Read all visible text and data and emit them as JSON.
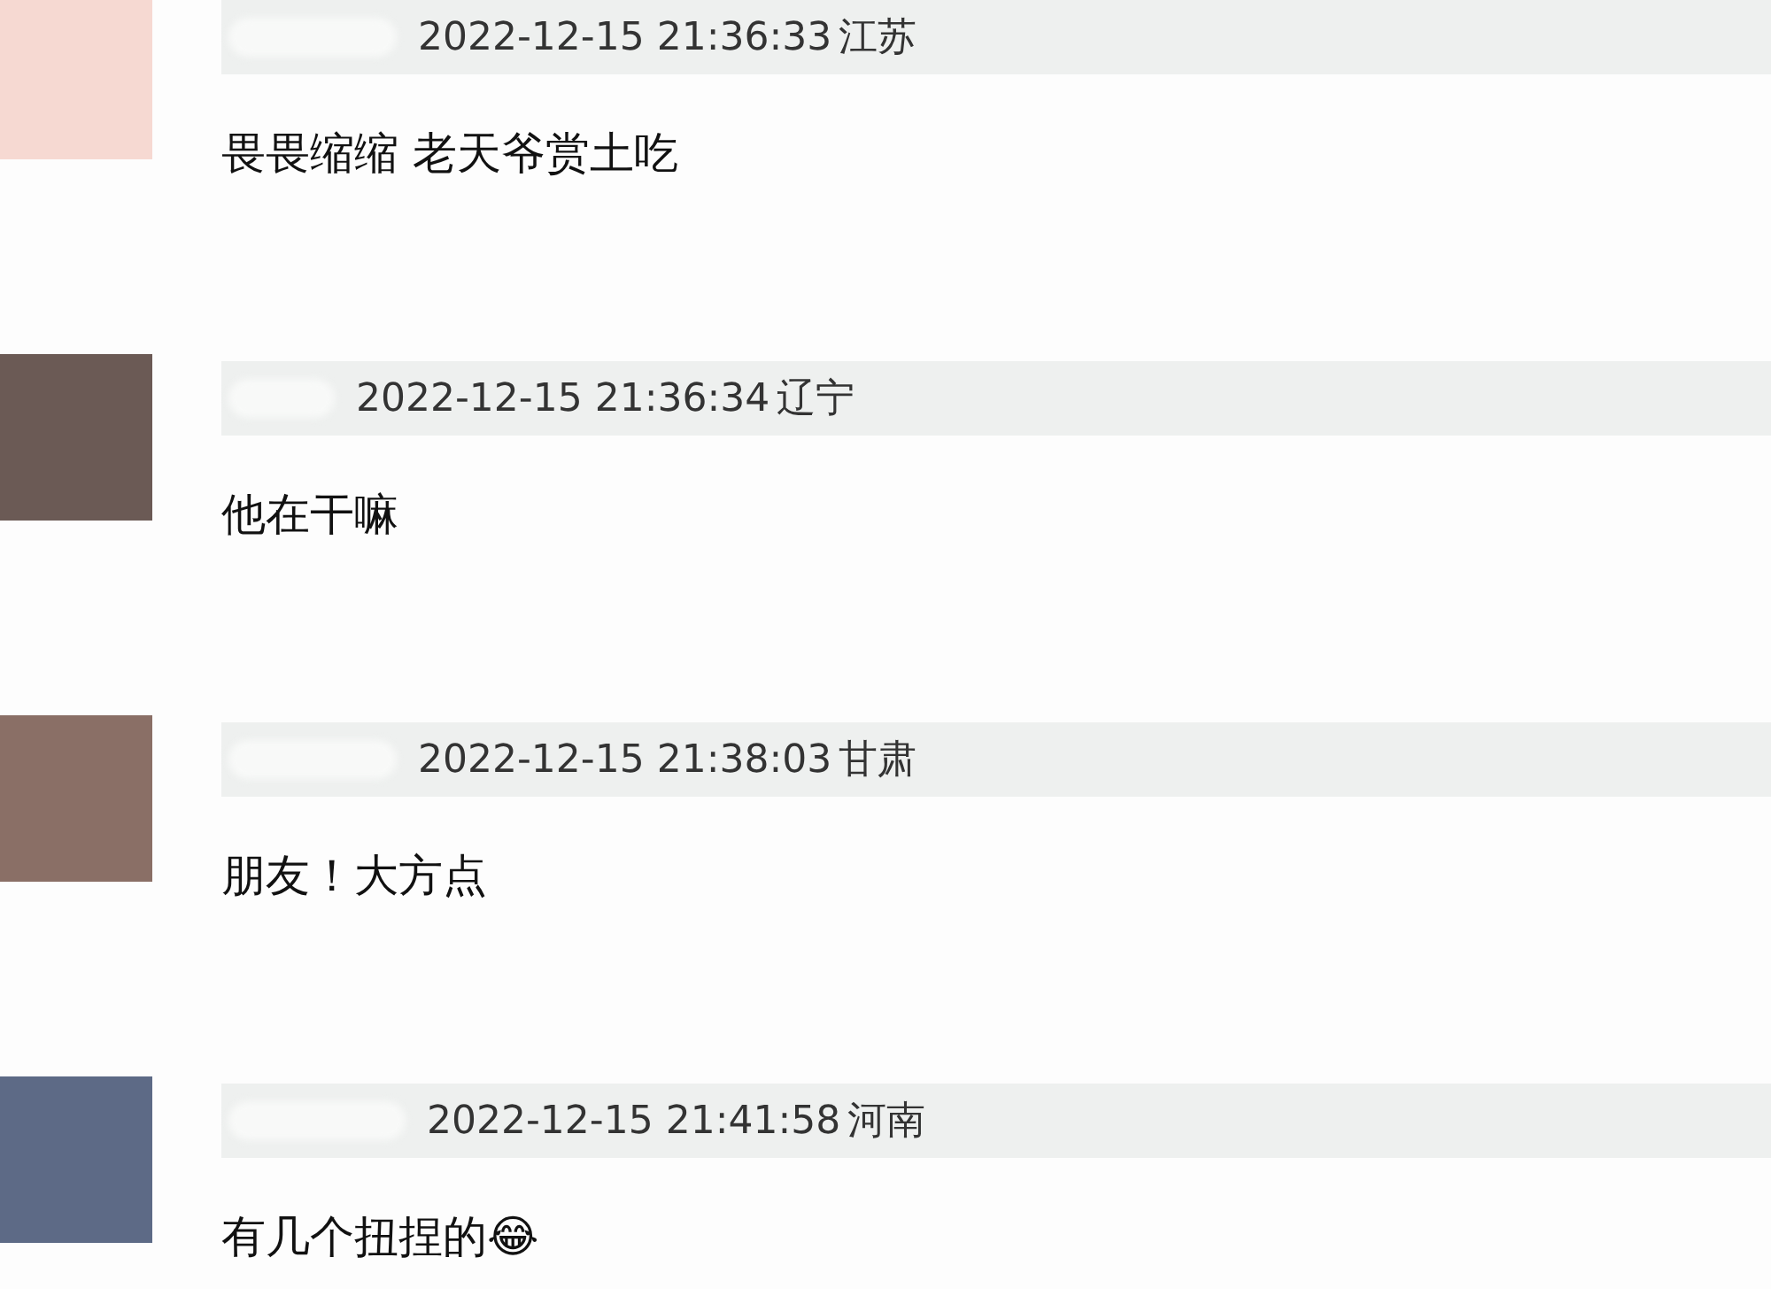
{
  "comments": [
    {
      "time": "2022-12-15 21:36:33",
      "region": "江苏",
      "text": "畏畏缩缩 老天爷赏土吃"
    },
    {
      "time": "2022-12-15 21:36:34",
      "region": "辽宁",
      "text": "他在干嘛"
    },
    {
      "time": "2022-12-15 21:38:03",
      "region": "甘肃",
      "text": "朋友！大方点"
    },
    {
      "time": "2022-12-15 21:41:58",
      "region": "河南",
      "text": "有几个扭捏的😂"
    }
  ]
}
